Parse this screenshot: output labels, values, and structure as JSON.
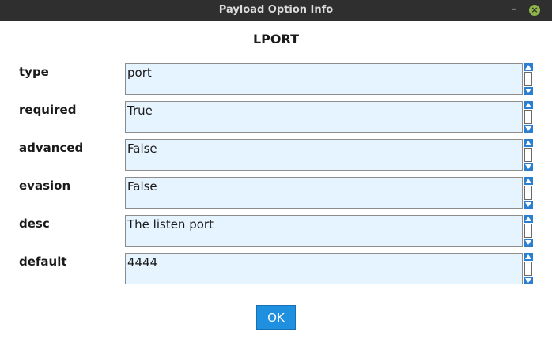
{
  "window": {
    "title": "Payload Option Info",
    "minimize_glyph": "–",
    "close_glyph": "×",
    "close_color": "#8fb54a"
  },
  "heading": "LPORT",
  "rows": [
    {
      "label": "type",
      "value": "port"
    },
    {
      "label": "required",
      "value": "True"
    },
    {
      "label": "advanced",
      "value": "False"
    },
    {
      "label": "evasion",
      "value": "False"
    },
    {
      "label": "desc",
      "value": "The listen port"
    },
    {
      "label": "default",
      "value": "4444"
    }
  ],
  "ok_button": {
    "label": "OK",
    "color": "#1f8fe0"
  },
  "field_background": "#e6f4ff"
}
